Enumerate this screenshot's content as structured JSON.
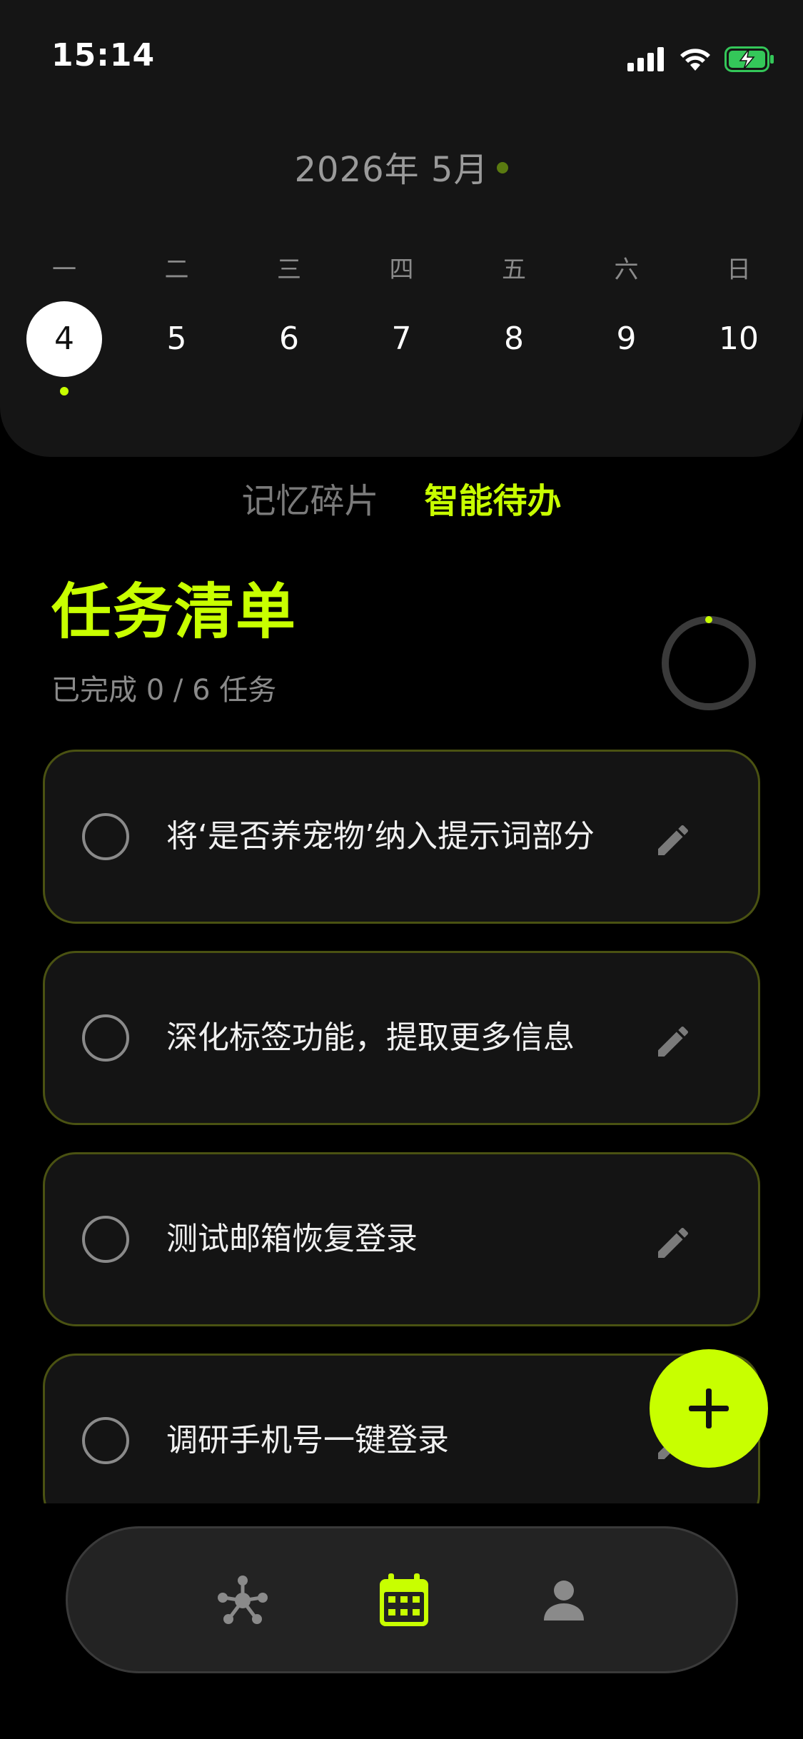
{
  "status_bar": {
    "time": "15:14"
  },
  "calendar": {
    "month_title": "2026年 5月",
    "weekdays": [
      "一",
      "二",
      "三",
      "四",
      "五",
      "六",
      "日"
    ],
    "days": [
      "4",
      "5",
      "6",
      "7",
      "8",
      "9",
      "10"
    ],
    "selected_index": 0
  },
  "tabs": [
    {
      "label": "记忆碎片",
      "active": false
    },
    {
      "label": "智能待办",
      "active": true
    }
  ],
  "task_section": {
    "title": "任务清单",
    "subtitle": "已完成 0 / 6 任务",
    "completed": 0,
    "total": 6
  },
  "tasks": [
    {
      "text": "将‘是否养宠物’纳入提示词部分",
      "done": false
    },
    {
      "text": "深化标签功能，提取更多信息",
      "done": false
    },
    {
      "text": "测试邮箱恢复登录",
      "done": false
    },
    {
      "text": "调研手机号一键登录",
      "done": false
    }
  ],
  "fab": {
    "icon": "plus-icon"
  },
  "bottom_nav": {
    "items": [
      {
        "icon": "network-icon",
        "active": false
      },
      {
        "icon": "calendar-icon",
        "active": true
      },
      {
        "icon": "person-icon",
        "active": false
      }
    ]
  },
  "colors": {
    "accent": "#c8ff00",
    "background": "#000000",
    "panel": "#151515",
    "card_border": "#4a5212",
    "muted_text": "#8a8a8a"
  }
}
